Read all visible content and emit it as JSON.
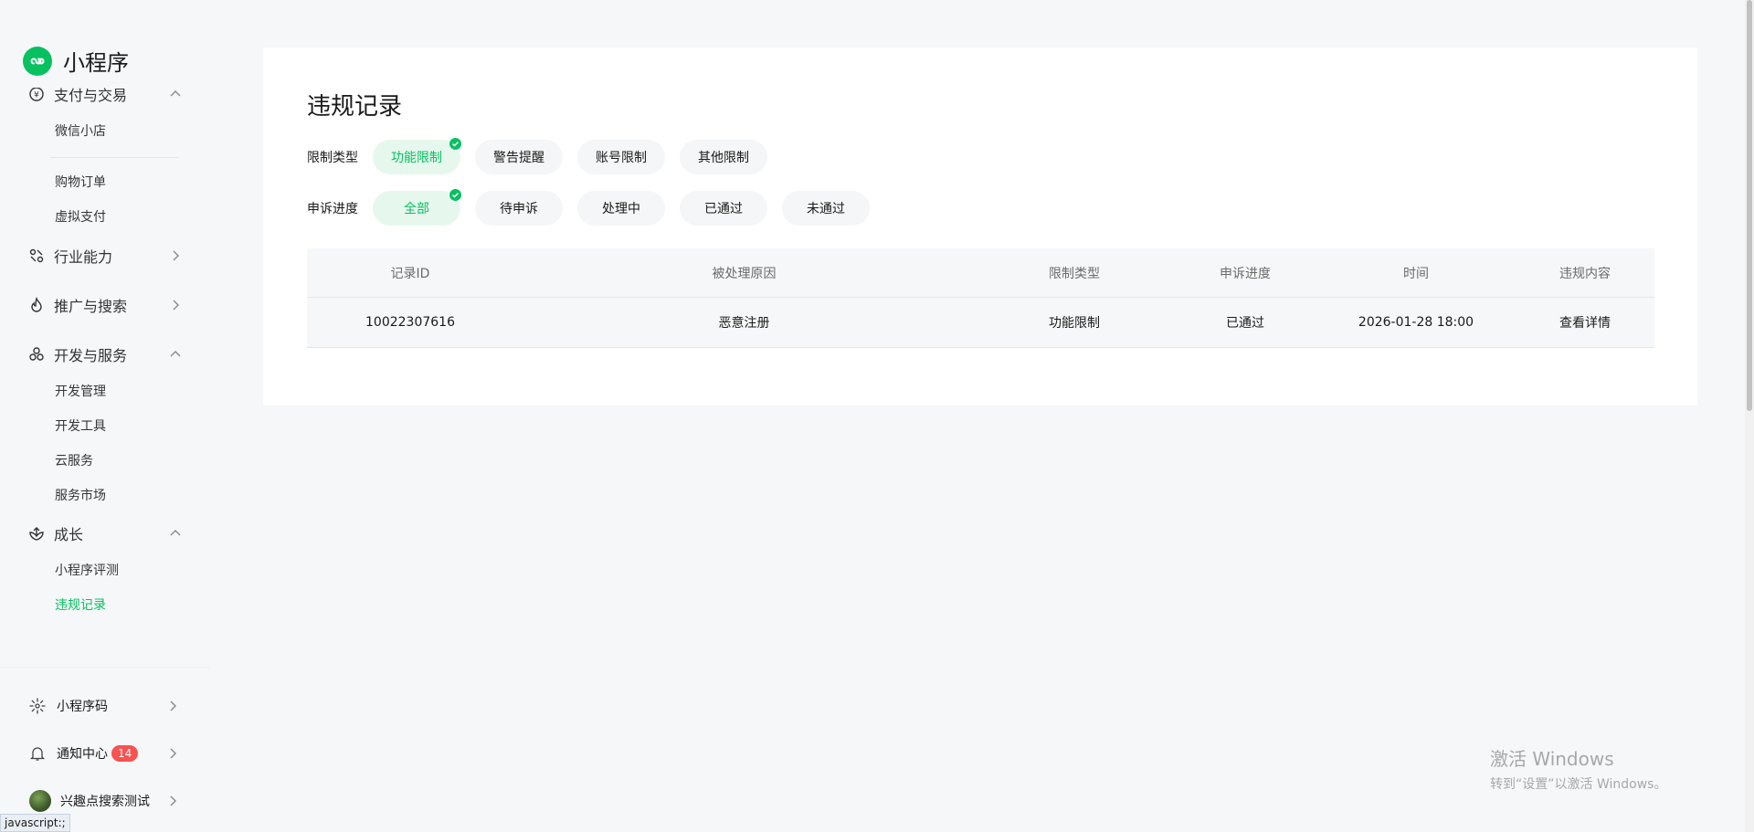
{
  "app": {
    "name": "小程序"
  },
  "sidebar": {
    "group_payment": {
      "label": "支付与交易"
    },
    "sub_weixin_store": "微信小店",
    "sub_orders": "购物订单",
    "sub_virtual_pay": "虚拟支付",
    "group_industry": {
      "label": "行业能力"
    },
    "group_promo": {
      "label": "推广与搜索"
    },
    "group_dev": {
      "label": "开发与服务"
    },
    "sub_dev_manage": "开发管理",
    "sub_dev_tools": "开发工具",
    "sub_cloud": "云服务",
    "sub_market": "服务市场",
    "group_growth": {
      "label": "成长"
    },
    "sub_review": "小程序评测",
    "sub_violations": "违规记录",
    "bottom": {
      "qrcode": "小程序码",
      "notify": "通知中心",
      "notify_badge": "14",
      "account": "兴趣点搜索测试"
    }
  },
  "main": {
    "title": "违规记录",
    "filters": {
      "type_label": "限制类型",
      "type_options": [
        "功能限制",
        "警告提醒",
        "账号限制",
        "其他限制"
      ],
      "type_selected": "功能限制",
      "appeal_label": "申诉进度",
      "appeal_options": [
        "全部",
        "待申诉",
        "处理中",
        "已通过",
        "未通过"
      ],
      "appeal_selected": "全部"
    },
    "table": {
      "headers": [
        "记录ID",
        "被处理原因",
        "限制类型",
        "申诉进度",
        "时间",
        "违规内容"
      ],
      "rows": [
        {
          "id": "10022307616",
          "reason": "恶意注册",
          "type": "功能限制",
          "status": "已通过",
          "time": "2026-01-28 18:00",
          "action": "查看详情"
        }
      ]
    }
  },
  "watermark": {
    "line1": "激活 Windows",
    "line2": "转到“设置”以激活 Windows。"
  },
  "statusbar": {
    "text": "javascript:;"
  },
  "colors": {
    "accent": "#07c160",
    "link": "#576b95",
    "badge": "#fa5151"
  }
}
